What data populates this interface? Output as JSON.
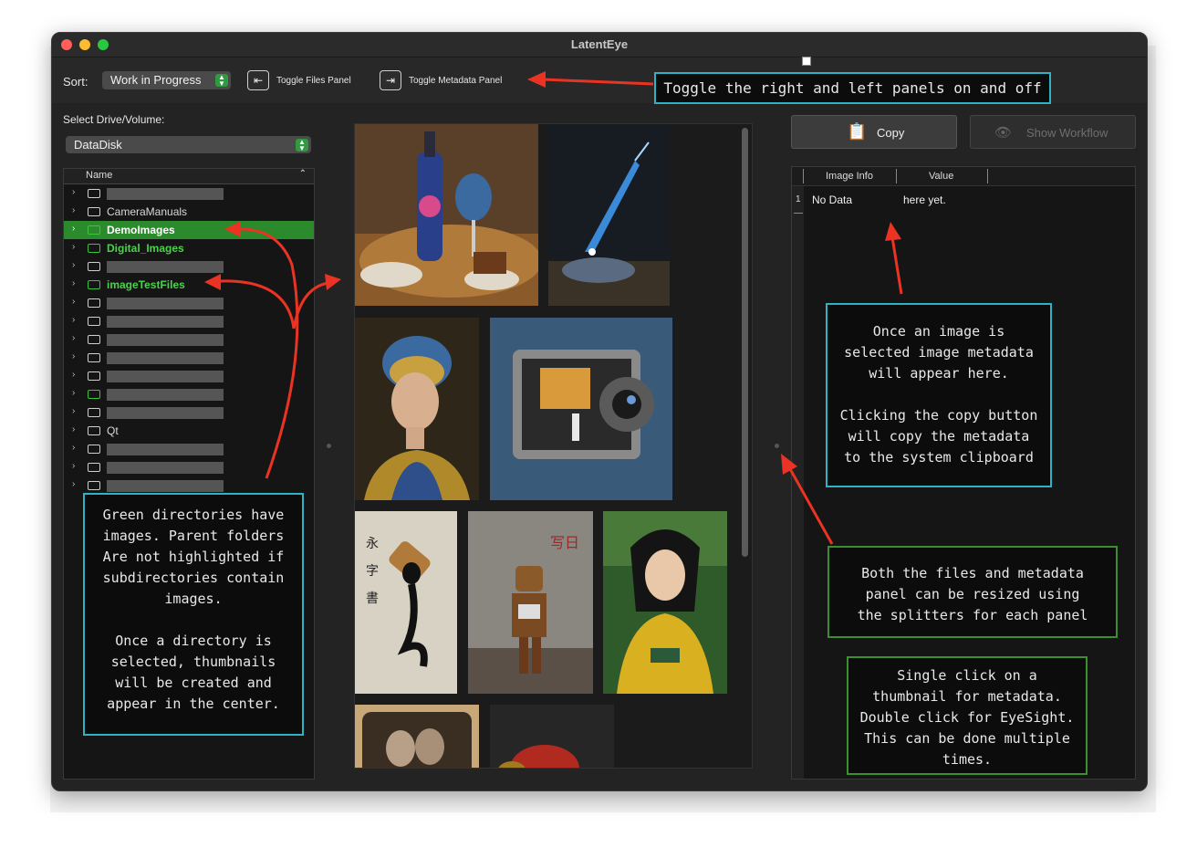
{
  "window": {
    "title": "LatentEye"
  },
  "toolbar": {
    "sort_label": "Sort:",
    "sort_value": "Work in Progress",
    "toggle_files_label": "Toggle Files Panel",
    "toggle_metadata_label": "Toggle Metadata Panel"
  },
  "files_panel": {
    "drive_label": "Select Drive/Volume:",
    "drive_value": "DataDisk",
    "column_header": "Name",
    "rows": [
      {
        "name": "",
        "redacted": true,
        "has_images": false
      },
      {
        "name": "CameraManuals",
        "redacted": false,
        "has_images": false
      },
      {
        "name": "DemoImages",
        "redacted": false,
        "has_images": true,
        "selected": true
      },
      {
        "name": "Digital_Images",
        "redacted": false,
        "has_images": true
      },
      {
        "name": "",
        "redacted": true,
        "has_images": false
      },
      {
        "name": "imageTestFiles",
        "redacted": false,
        "has_images": true
      },
      {
        "name": "",
        "redacted": true,
        "has_images": false
      },
      {
        "name": "",
        "redacted": true,
        "has_images": false
      },
      {
        "name": "",
        "redacted": true,
        "has_images": false
      },
      {
        "name": "",
        "redacted": true,
        "has_images": false
      },
      {
        "name": "",
        "redacted": true,
        "has_images": false
      },
      {
        "name": "",
        "redacted": true,
        "has_images": true
      },
      {
        "name": "",
        "redacted": true,
        "has_images": false
      },
      {
        "name": "Qt",
        "redacted": false,
        "has_images": false
      },
      {
        "name": "",
        "redacted": true,
        "has_images": false
      },
      {
        "name": "",
        "redacted": true,
        "has_images": false
      },
      {
        "name": "",
        "redacted": true,
        "has_images": false
      }
    ]
  },
  "thumbnails": [
    {
      "subject": "wine bottle with galaxy and meal on table",
      "colors": [
        "#6b4a2c",
        "#c98a3a",
        "#2a4d8c"
      ]
    },
    {
      "subject": "glowing blue quill over paper",
      "colors": [
        "#1a1f26",
        "#3a86c8",
        "#8a6a3a"
      ]
    },
    {
      "subject": "portrait of woman with headscarf",
      "colors": [
        "#3a2f1f",
        "#c8a060",
        "#2f4f7a"
      ]
    },
    {
      "subject": "vintage camera with tiny painter",
      "colors": [
        "#4a6a8a",
        "#7a7a7a",
        "#c87a2a"
      ]
    },
    {
      "subject": "ink brush calligraphy",
      "colors": [
        "#d9d4c8",
        "#1a1a1a",
        "#b08040"
      ]
    },
    {
      "subject": "robot sitting by graffiti wall",
      "colors": [
        "#8a8580",
        "#6a4a2a",
        "#a03a2a"
      ]
    },
    {
      "subject": "woman in yellow kimono in garden",
      "colors": [
        "#2f5a2a",
        "#d8b020",
        "#1a1a1a"
      ]
    },
    {
      "subject": "old couple photograph",
      "colors": [
        "#c8a878",
        "#4a3a2a",
        "#2a2a2a"
      ]
    },
    {
      "subject": "red object dark background",
      "colors": [
        "#2a2a2a",
        "#b02a20",
        "#3a3a3a"
      ]
    }
  ],
  "metadata_panel": {
    "copy_label": "Copy",
    "workflow_label": "Show Workflow",
    "col_image_info": "Image Info",
    "col_value": "Value",
    "row_number": "1",
    "row_info": "No Data",
    "row_value": "here yet."
  },
  "annotations": {
    "toggle_note": "Toggle the right and left panels on and off",
    "metadata_note": "Once an image is\nselected image metadata\nwill appear here.\n\nClicking the copy button\nwill copy the metadata\nto the system clipboard",
    "directories_note": "Green directories have\nimages. Parent folders\nAre not highlighted if\nsubdirectories contain\nimages.\n\nOnce a directory is\nselected, thumbnails\nwill be created and\nappear in the center.",
    "resize_note": "Both the files and metadata\npanel can be resized using\nthe splitters for each panel",
    "click_note": "Single click on a\nthumbnail for metadata.\nDouble click for EyeSight.\nThis can be done multiple\ntimes."
  },
  "colors": {
    "accent_green": "#2b8a2b",
    "image_folder_text": "#4ad24a",
    "annotation_cyan": "#2fb3c4",
    "annotation_green": "#3c8f2f",
    "arrow_red": "#ea3323"
  }
}
